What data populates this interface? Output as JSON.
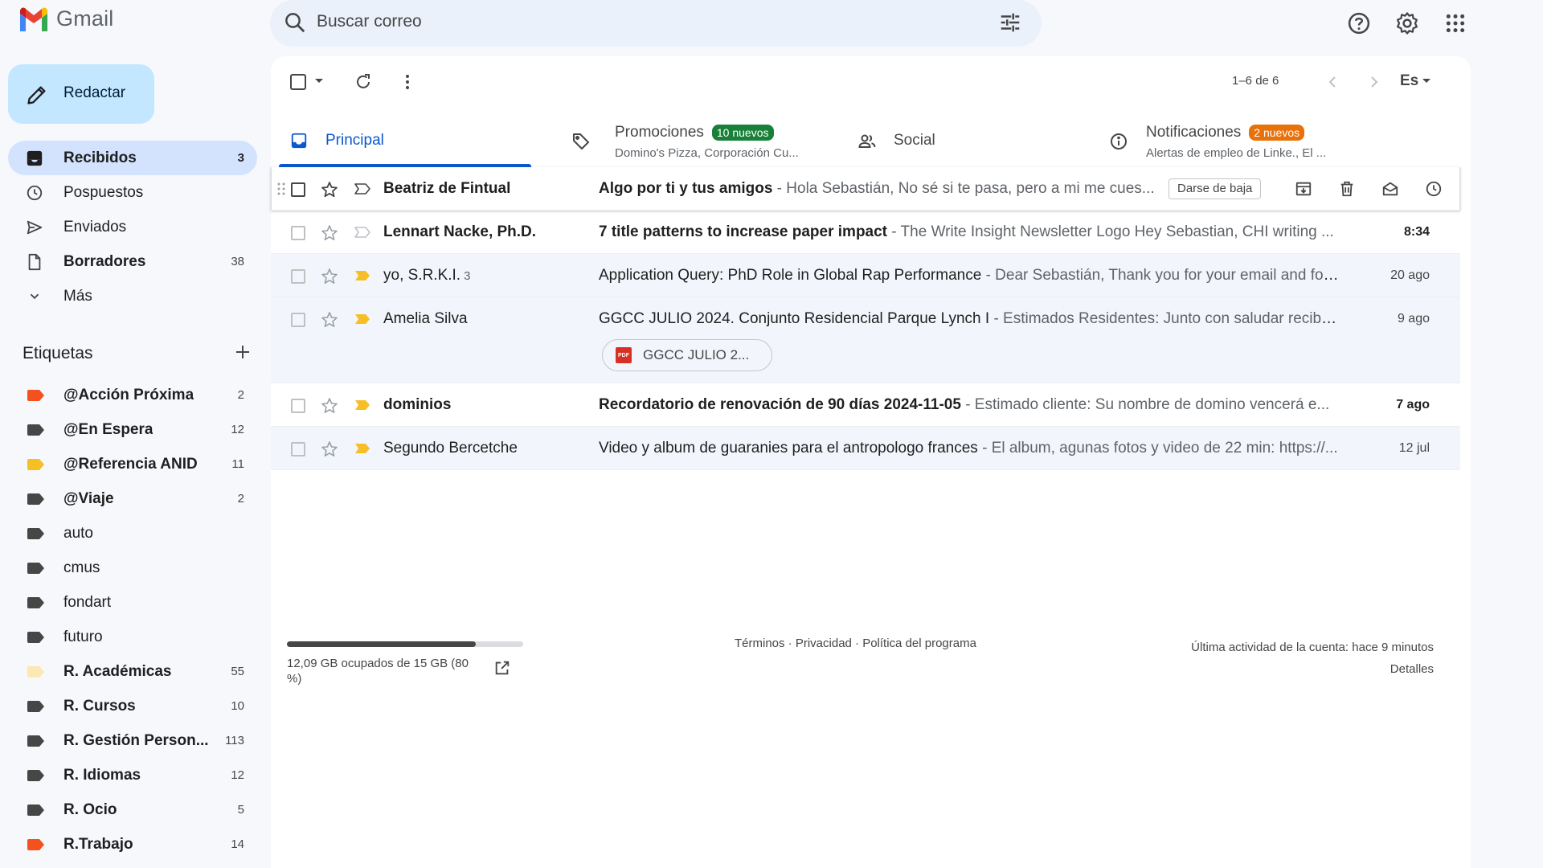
{
  "app": {
    "name": "Gmail"
  },
  "search": {
    "placeholder": "Buscar correo"
  },
  "compose": {
    "label": "Redactar"
  },
  "nav": [
    {
      "label": "Recibidos",
      "count": "3",
      "icon": "inbox-icon",
      "active": true,
      "bold": true
    },
    {
      "label": "Pospuestos",
      "count": "",
      "icon": "clock-icon",
      "active": false,
      "bold": false
    },
    {
      "label": "Enviados",
      "count": "",
      "icon": "send-icon",
      "active": false,
      "bold": false
    },
    {
      "label": "Borradores",
      "count": "38",
      "icon": "draft-icon",
      "active": false,
      "bold": true
    },
    {
      "label": "Más",
      "count": "",
      "icon": "chevron-down-icon",
      "active": false,
      "bold": false
    }
  ],
  "labels_header": "Etiquetas",
  "labels": [
    {
      "name": "@Acción Próxima",
      "count": "2",
      "color": "#f4511e",
      "bold": true
    },
    {
      "name": "@En Espera",
      "count": "12",
      "color": "#444746",
      "bold": true
    },
    {
      "name": "@Referencia ANID",
      "count": "11",
      "color": "#f6bf26",
      "bold": true
    },
    {
      "name": "@Viaje",
      "count": "2",
      "color": "#444746",
      "bold": true
    },
    {
      "name": "auto",
      "count": "",
      "color": "#444746",
      "bold": false
    },
    {
      "name": "cmus",
      "count": "",
      "color": "#444746",
      "bold": false
    },
    {
      "name": "fondart",
      "count": "",
      "color": "#444746",
      "bold": false
    },
    {
      "name": "futuro",
      "count": "",
      "color": "#444746",
      "bold": false
    },
    {
      "name": "R. Académicas",
      "count": "55",
      "color": "#fce8b2",
      "bold": true
    },
    {
      "name": "R. Cursos",
      "count": "10",
      "color": "#444746",
      "bold": true
    },
    {
      "name": "R. Gestión Person...",
      "count": "113",
      "color": "#444746",
      "bold": true
    },
    {
      "name": "R. Idiomas",
      "count": "12",
      "color": "#444746",
      "bold": true
    },
    {
      "name": "R. Ocio",
      "count": "5",
      "color": "#444746",
      "bold": true
    },
    {
      "name": "R.Trabajo",
      "count": "14",
      "color": "#f4511e",
      "bold": true
    }
  ],
  "toolbar": {
    "pagination": "1–6 de 6",
    "lang": "Es"
  },
  "tabs": [
    {
      "name": "Principal",
      "badge": "",
      "sub": "",
      "icon": "inbox-tab-icon"
    },
    {
      "name": "Promociones",
      "badge": "10 nuevos",
      "sub": "Domino's Pizza, Corporación Cu...",
      "icon": "tag-icon"
    },
    {
      "name": "Social",
      "badge": "",
      "sub": "",
      "icon": "people-icon"
    },
    {
      "name": "Notificaciones",
      "badge": "2 nuevos",
      "sub": "Alertas de empleo de Linke., El ...",
      "icon": "info-icon"
    }
  ],
  "emails": [
    {
      "sender": "Beatriz de Fintual",
      "thread_count": "",
      "subject": "Algo por ti y tus amigos",
      "snippet": " - Hola Sebastián, No sé si te pasa, pero a mi me cues...",
      "date": "",
      "unread": true,
      "important": false,
      "hover": true,
      "unsubscribe": "Darse de baja"
    },
    {
      "sender": "Lennart Nacke, Ph.D.",
      "thread_count": "",
      "subject": "7 title patterns to increase paper impact",
      "snippet": " - The Write Insight Newsletter Logo Hey Sebastian, CHI writing ...",
      "date": "8:34",
      "unread": true,
      "important": false
    },
    {
      "sender": "yo, S.R.K.I.",
      "thread_count": "3",
      "subject": "Application Query: PhD Role in Global Rap Performance",
      "snippet": " - Dear Sebastián, Thank you for your email and for ...",
      "date": "20 ago",
      "unread": false,
      "important": true
    },
    {
      "sender": "Amelia Silva",
      "thread_count": "",
      "subject": "GGCC JULIO 2024. Conjunto Residencial Parque Lynch I",
      "snippet": " - Estimados Residentes: Junto con saludar reciba...",
      "date": "9 ago",
      "unread": false,
      "important": true,
      "attachment": "GGCC JULIO 2..."
    },
    {
      "sender": "dominios",
      "thread_count": "",
      "subject": "Recordatorio de renovación de 90 días 2024-11-05",
      "snippet": " - Estimado cliente: Su nombre de domino vencerá e...",
      "date": "7 ago",
      "unread": true,
      "important": true
    },
    {
      "sender": "Segundo Bercetche",
      "thread_count": "",
      "subject": "Video y album de guaranies para el antropologo frances",
      "snippet": " - El album, agunas fotos y video de 22 min: https://...",
      "date": "12 jul",
      "unread": false,
      "important": true
    }
  ],
  "footer": {
    "storage_text": "12,09 GB ocupados de 15 GB (80 %)",
    "storage_fraction": 0.8,
    "links": "Términos · Privacidad · Política del programa",
    "activity": "Última actividad de la cuenta: hace 9 minutos",
    "details": "Detalles"
  }
}
